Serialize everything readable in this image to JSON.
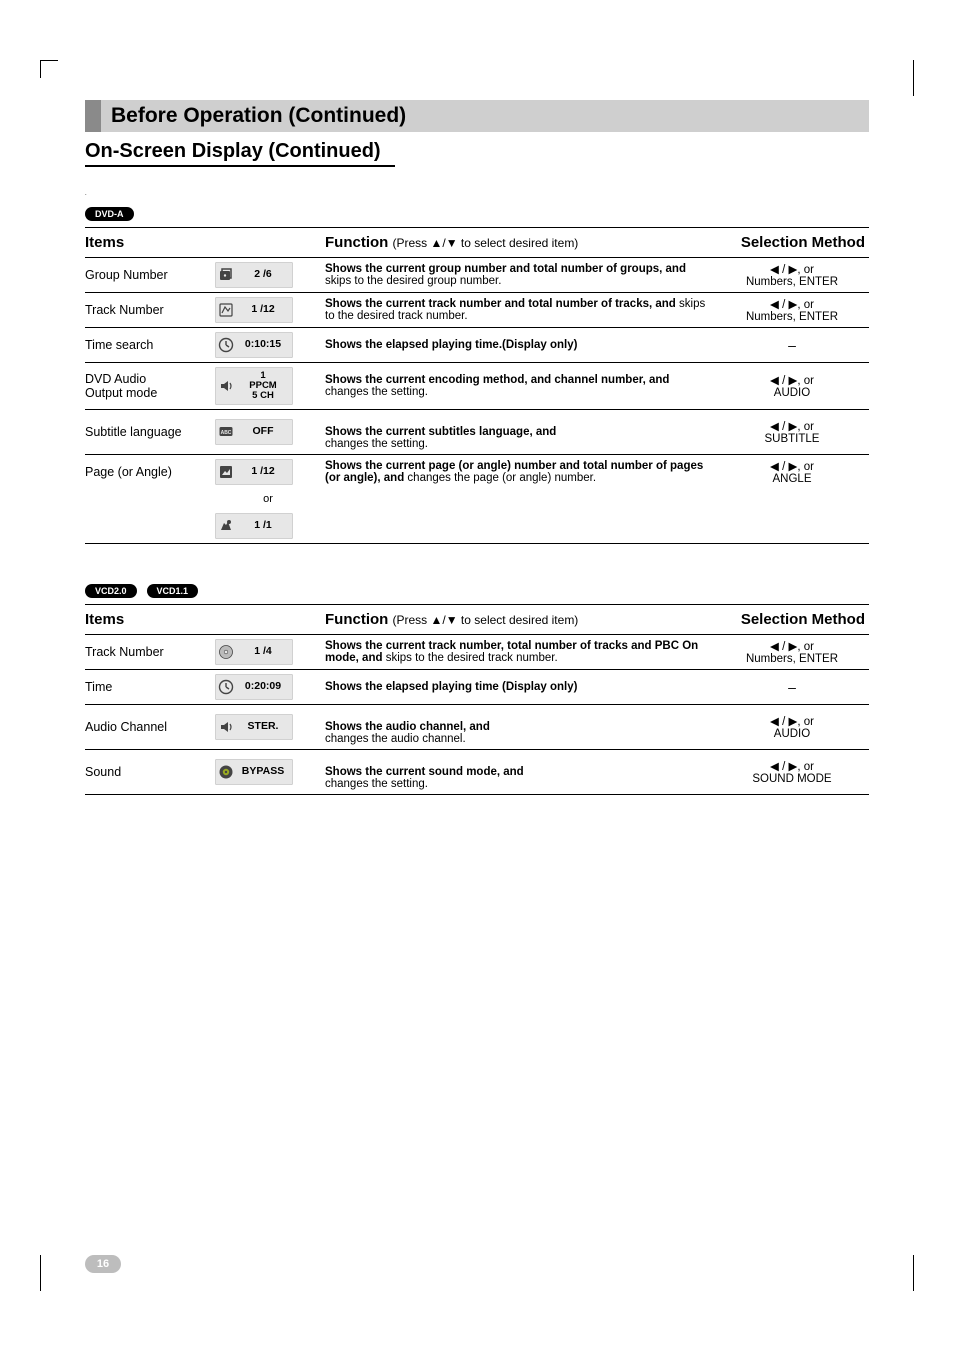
{
  "header": {
    "title": "Before Operation (Continued)",
    "subtitle_main": "On-Screen Display",
    "subtitle_cont": "(Continued)"
  },
  "tables": [
    {
      "badges": [
        "DVD-A"
      ],
      "head": {
        "items": "Items",
        "function": "Function",
        "hint": "(Press ▲/▼ to select desired item)",
        "selection": "Selection Method"
      },
      "rows": [
        {
          "item": "Group Number",
          "pill": {
            "icon": "group-icon",
            "text": "2 /6"
          },
          "func_bold": "Shows the current group number and total number of groups, and",
          "func_rest": " skips to the desired group number.",
          "sel_line1": "◀ / ▶, or",
          "sel_line2": "Numbers, ENTER"
        },
        {
          "item": "Track Number",
          "pill": {
            "icon": "track-icon",
            "text": "1 /12"
          },
          "func_bold": "Shows the current track number and total number of tracks, and",
          "func_rest": " skips to the desired track number.",
          "sel_line1": "◀ / ▶, or",
          "sel_line2": "Numbers, ENTER"
        },
        {
          "item": "Time search",
          "pill": {
            "icon": "clock-icon",
            "text": "0:10:15"
          },
          "func_bold": "Shows the elapsed playing time.(Display only)",
          "func_rest": "",
          "sel_line1": "–",
          "sel_line2": ""
        },
        {
          "item": "DVD Audio\nOutput mode",
          "pill": {
            "icon": "speaker-icon",
            "text": "1\nPPCM\n5 CH"
          },
          "func_bold": "Shows the current encoding method, and channel number, and",
          "func_rest": " changes the setting.",
          "sel_line1": "◀ / ▶, or",
          "sel_line2": "AUDIO"
        },
        {
          "item": "Subtitle language",
          "pill": {
            "icon": "subtitle-icon",
            "text": "OFF"
          },
          "func_bold": "Shows the current subtitles language, and",
          "func_rest": "\nchanges the setting.",
          "sel_line1": "◀ / ▶, or",
          "sel_line2": "SUBTITLE"
        },
        {
          "item": "Page (or Angle)",
          "pill": {
            "icon": "page-icon",
            "text": "1 /12"
          },
          "func_bold": "Shows the current page (or angle) number and total number of pages (or angle), and",
          "func_rest": " changes the page (or angle) number.",
          "sel_line1": "◀ / ▶, or",
          "sel_line2": "ANGLE",
          "extra_or": "or",
          "extra_pill": {
            "icon": "angle-icon",
            "text": "1 /1"
          }
        }
      ]
    },
    {
      "badges": [
        "VCD2.0",
        "VCD1.1"
      ],
      "head": {
        "items": "Items",
        "function": "Function",
        "hint": "(Press ▲/▼ to select desired item)",
        "selection": "Selection Method"
      },
      "rows": [
        {
          "item": "Track Number",
          "pill": {
            "icon": "disc-icon",
            "text": "1 /4"
          },
          "func_bold": "Shows the current track number, total number of tracks and PBC On mode, and",
          "func_rest": " skips to the desired track number.",
          "sel_line1": "◀ / ▶, or",
          "sel_line2": "Numbers, ENTER"
        },
        {
          "item": "Time",
          "pill": {
            "icon": "clock2-icon",
            "text": "0:20:09"
          },
          "func_bold": "Shows the elapsed playing time (Display only)",
          "func_rest": "",
          "sel_line1": "–",
          "sel_line2": ""
        },
        {
          "item": "Audio Channel",
          "pill": {
            "icon": "speaker-icon",
            "text": "STER."
          },
          "func_bold": "Shows the audio channel, and",
          "func_rest": "\nchanges the audio channel.",
          "sel_line1": "◀ / ▶, or",
          "sel_line2": "AUDIO"
        },
        {
          "item": "Sound",
          "pill": {
            "icon": "sound-icon",
            "text": "BYPASS"
          },
          "func_bold": "Shows the current sound mode, and",
          "func_rest": "\nchanges the setting.",
          "sel_line1": "◀ / ▶, or",
          "sel_line2": "SOUND MODE"
        }
      ]
    }
  ],
  "page_number": "16"
}
